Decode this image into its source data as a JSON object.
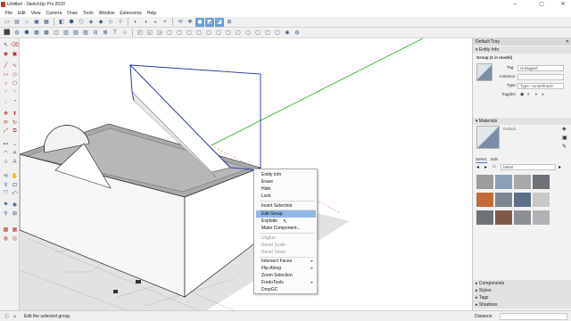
{
  "window": {
    "title": "Untitled - SketchUp Pro 2020",
    "minimize": "–",
    "maximize": "▢",
    "close": "✕"
  },
  "menu": [
    "File",
    "Edit",
    "View",
    "Camera",
    "Draw",
    "Tools",
    "Window",
    "Extensions",
    "Help"
  ],
  "context_menu": {
    "items": [
      {
        "label": "Entity Info",
        "state": "normal",
        "submenu": false
      },
      {
        "label": "Erase",
        "state": "normal",
        "submenu": false
      },
      {
        "label": "Hide",
        "state": "normal",
        "submenu": false
      },
      {
        "label": "Lock",
        "state": "normal",
        "submenu": false
      },
      {
        "label": "Invert Selection",
        "state": "normal",
        "submenu": false
      },
      {
        "label": "Edit Group",
        "state": "highlighted",
        "submenu": false
      },
      {
        "label": "Explode",
        "state": "normal",
        "submenu": false
      },
      {
        "label": "Make Component...",
        "state": "normal",
        "submenu": false
      },
      {
        "label": "Unglue",
        "state": "disabled",
        "submenu": false
      },
      {
        "label": "Reset Scale",
        "state": "disabled",
        "submenu": false
      },
      {
        "label": "Reset Skew",
        "state": "disabled",
        "submenu": false
      },
      {
        "label": "Intersect Faces",
        "state": "normal",
        "submenu": true
      },
      {
        "label": "Flip Along",
        "state": "normal",
        "submenu": true
      },
      {
        "label": "Zoom Selection",
        "state": "normal",
        "submenu": false
      },
      {
        "label": "FredoTools",
        "state": "normal",
        "submenu": true
      },
      {
        "label": "DropGC",
        "state": "normal",
        "submenu": false
      }
    ],
    "submenu_arrow": "▸"
  },
  "tray": {
    "title": "Default Tray",
    "entity_info": {
      "header": "Entity Info",
      "entity": "Group (1 in model)",
      "tag_label": "Tag:",
      "tag_value": "Untagged",
      "instance_label": "Instance:",
      "instance_value": "",
      "type_label": "Type:",
      "type_value": "Type: <undefined>",
      "toggles_label": "Toggles:"
    },
    "materials": {
      "header": "Materials",
      "current_name": "Default",
      "tab_select": "Select",
      "tab_edit": "Edit",
      "library": "Metal",
      "swatch_colors": [
        "#9a9c9e",
        "#8aa0b8",
        "#a8a8a8",
        "#6f7378",
        "#c46a3a",
        "#7d8691",
        "#5d6f86",
        "#c9c9c9",
        "#6f7276",
        "#7f5a4a",
        "#8b8e93",
        "#b0b2b4"
      ]
    },
    "collapsed": [
      "Components",
      "Styles",
      "Tags",
      "Shadows"
    ]
  },
  "status": {
    "hint": "Edit the selected group.",
    "measure_label": "Distance"
  },
  "colors": {
    "selection_blue": "#2030a8",
    "axis_green": "#2ca02c",
    "menu_highlight": "#8fb8e6"
  }
}
